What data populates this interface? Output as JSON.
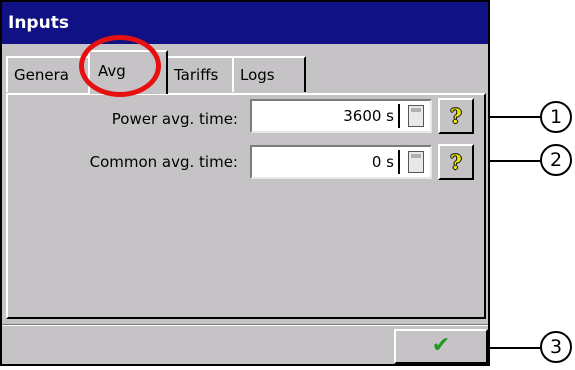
{
  "window": {
    "title": "Inputs"
  },
  "tabs": [
    {
      "label": "Genera"
    },
    {
      "label": "Avg"
    },
    {
      "label": "Tariffs"
    },
    {
      "label": "Logs"
    }
  ],
  "rows": [
    {
      "label": "Power avg. time:",
      "value": "3600 s"
    },
    {
      "label": "Common avg. time:",
      "value": "0 s"
    }
  ],
  "buttons": {
    "help_glyph": "?",
    "ok_glyph": "✔"
  },
  "callouts": [
    "1",
    "2",
    "3"
  ],
  "icons": {
    "field": "calculator-icon",
    "help": "question-mark-icon",
    "ok": "checkmark-icon"
  },
  "colors": {
    "titlebar": "#0f1184",
    "highlight": "#e61010",
    "ok": "#1f9a1f"
  }
}
